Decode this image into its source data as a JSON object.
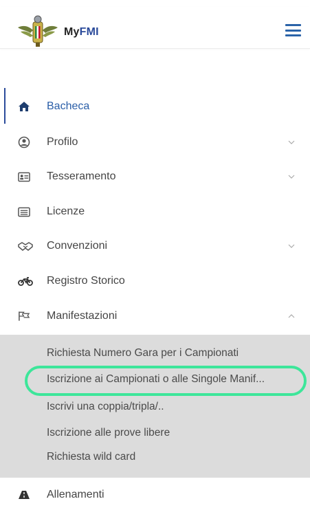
{
  "app": {
    "brand_my": "My",
    "brand_fmi": "FMI"
  },
  "menu": {
    "items": [
      {
        "label": "Bacheca",
        "icon": "home-icon",
        "expandable": false,
        "active": true
      },
      {
        "label": "Profilo",
        "icon": "user-circle-icon",
        "expandable": true
      },
      {
        "label": "Tesseramento",
        "icon": "id-card-icon",
        "expandable": true
      },
      {
        "label": "Licenze",
        "icon": "list-icon",
        "expandable": false
      },
      {
        "label": "Convenzioni",
        "icon": "handshake-icon",
        "expandable": true
      },
      {
        "label": "Registro Storico",
        "icon": "motorcycle-icon",
        "expandable": false
      },
      {
        "label": "Manifestazioni",
        "icon": "flag-icon",
        "expandable": true,
        "expanded": true
      },
      {
        "label": "Allenamenti",
        "icon": "road-icon",
        "expandable": false
      }
    ],
    "manifestazioni_sub": [
      "Richiesta Numero Gara per i Campionati",
      "Iscrizione ai Campionati o alle Singole Manif...",
      "Iscrivi una coppia/tripla/..",
      "Iscrizione alle prove libere",
      "Richiesta wild card"
    ]
  },
  "colors": {
    "accent": "#2a5ea8",
    "highlight": "#3de69a",
    "submenu_bg": "#dcdcdc"
  }
}
